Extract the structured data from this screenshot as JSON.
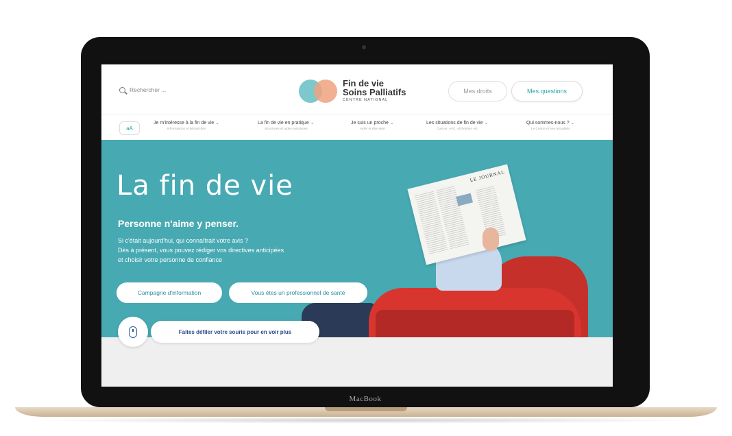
{
  "device": {
    "brand": "MacBook"
  },
  "header": {
    "search_placeholder": "Rechercher ...",
    "logo": {
      "line1": "Fin de vie",
      "line2": "Soins Palliatifs",
      "line3": "CENTRE NATIONAL"
    },
    "buttons": {
      "rights": "Mes droits",
      "questions": "Mes questions"
    }
  },
  "nav": {
    "font_size_label": "aA",
    "items": [
      {
        "title": "Je m'intéresse à la fin de vie",
        "subtitle": "Informations et démarches"
      },
      {
        "title": "La fin de vie en pratique",
        "subtitle": "Structures et aides existantes"
      },
      {
        "title": "Je suis un proche",
        "subtitle": "Aider et être aidé"
      },
      {
        "title": "Les situations de fin de vie",
        "subtitle": "Cancer, AVC, Alzheimer, etc"
      },
      {
        "title": "Qui sommes-nous ?",
        "subtitle": "Le Centre et ses actualités"
      }
    ]
  },
  "hero": {
    "title": "La fin de vie",
    "subtitle": "Personne n'aime y penser.",
    "paragraph_lines": [
      "Si c'était aujourd'hui, qui connaîtrait votre avis ?",
      "Dès à présent, vous pouvez rédiger vos directives anticipées",
      "et choisir votre personne de confiance"
    ],
    "button_campaign": "Campagne d'information",
    "button_pro": "Vous êtes un professionnel de santé",
    "newspaper_headline": "LE JOURNAL"
  },
  "scroll_hint": {
    "label": "Faites défiler votre souris pour en voir plus"
  },
  "colors": {
    "accent": "#47a9b2",
    "teal_text": "#2aa6a6",
    "chair": "#c6302b"
  }
}
